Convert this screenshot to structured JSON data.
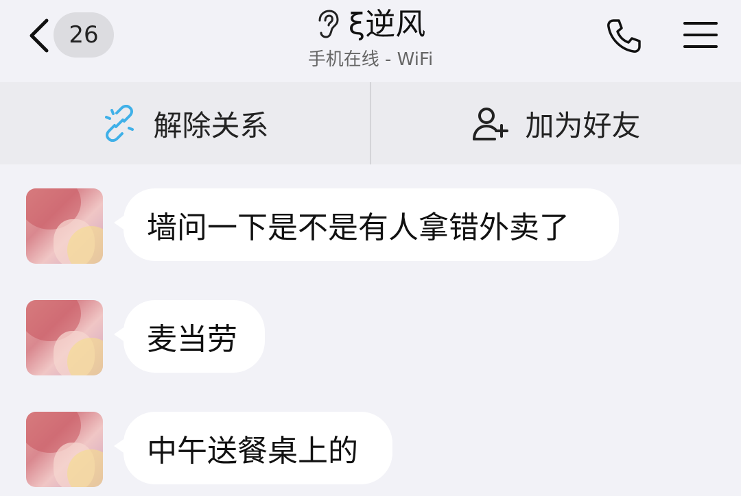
{
  "header": {
    "unread_count": "26",
    "contact_name": "ξ逆风",
    "status": "手机在线 - WiFi",
    "icons": {
      "back": "chevron-left-icon",
      "ear": "ear-icon",
      "phone": "phone-icon",
      "menu": "hamburger-menu-icon"
    }
  },
  "actions": [
    {
      "label": "解除关系",
      "icon": "broken-link-icon",
      "icon_color": "#3fb0e8"
    },
    {
      "label": "加为好友",
      "icon": "add-user-icon",
      "icon_color": "#222222"
    }
  ],
  "messages": [
    {
      "text": "墙问一下是不是有人拿错外卖了"
    },
    {
      "text": "麦当劳"
    },
    {
      "text": "中午送餐桌上的"
    }
  ],
  "colors": {
    "background": "#f2f2f7",
    "bubble": "#ffffff",
    "action_bar": "#ebebef"
  }
}
